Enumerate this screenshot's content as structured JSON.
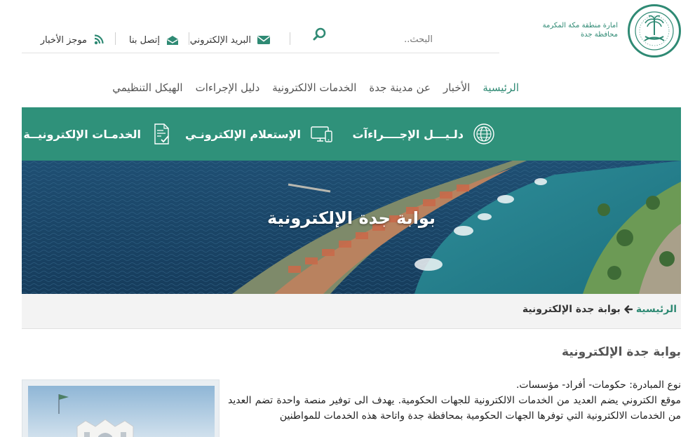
{
  "header": {
    "org_line1": "امارة منطقة مكة المكرمة",
    "org_line2": "محافظة جدة",
    "search_placeholder": "البحث..",
    "links": {
      "email": "البريد الإلكتروني",
      "contact": "إتصل بنا",
      "news_feed": "موجز الأخبار"
    }
  },
  "nav": {
    "items": [
      {
        "label": "الرئيسية",
        "active": true
      },
      {
        "label": "الأخبار"
      },
      {
        "label": "عن مدينة جدة"
      },
      {
        "label": "الخدمات الالكترونية"
      },
      {
        "label": "دليل الإجراءات"
      },
      {
        "label": "الهيكل التنظيمي"
      }
    ]
  },
  "band": {
    "items": [
      {
        "label": "دلـيـــل الإجــــراءآت",
        "icon": "globe-icon"
      },
      {
        "label": "الإستعلام الإلكترونـي",
        "icon": "devices-icon"
      },
      {
        "label": "الخدمـات الإلكترونيــة",
        "icon": "document-check-icon"
      }
    ]
  },
  "hero": {
    "title": "بوابة جدة الإلكترونية"
  },
  "breadcrumb": {
    "home": "الرئيسية",
    "current": "بوابة جدة الإلكترونية"
  },
  "content": {
    "heading": "بوابة جدة الإلكترونية",
    "line1": "نوع المبادرة: حكومات- أفراد- مؤسسات.",
    "paragraph": "موقع الكتروني يضم العديد من الخدمات الالكترونية للجهات الحكومية. يهدف الى توفير منصة واحدة تضم العديد من الخدمات الالكترونية التي توفرها الجهات الحكومية بمحافظة جدة واتاحة هذه الخدمات للمواطنين"
  },
  "colors": {
    "brand_green": "#2f917a",
    "text_green": "#2f8a74"
  }
}
